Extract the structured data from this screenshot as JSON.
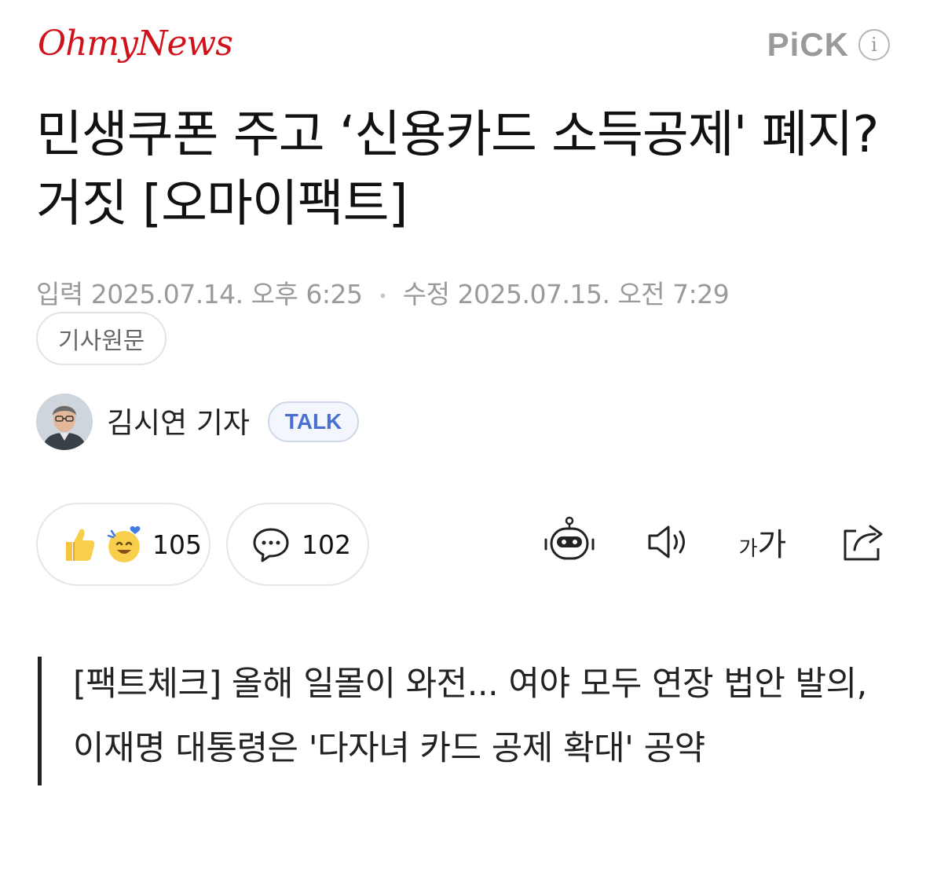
{
  "header": {
    "logo": "OhmyNews",
    "pick_label": "PiCK",
    "info_icon": "info-icon",
    "info_glyph": "i"
  },
  "article": {
    "headline": "민생쿠폰 주고 ‘신용카드 소득공제' 폐지? 거짓 [오마이팩트]",
    "input_label": "입력",
    "input_datetime": "2025.07.14. 오후 6:25",
    "modified_label": "수정",
    "modified_datetime": "2025.07.15. 오전 7:29",
    "separator": "•",
    "source_button": "기사원문",
    "reporter_name": "김시연 기자",
    "talk_label": "TALK",
    "reaction_count": "105",
    "comment_count": "102",
    "font_small": "가",
    "font_big": "가",
    "summary": "[팩트체크] 올해 일몰이 와전... 여야 모두 연장 법안 발의, 이재명 대통령은 '다자녀 카드 공제 확대' 공약"
  },
  "colors": {
    "brand_red": "#d0121a",
    "talk_blue": "#4a6fd3",
    "meta_gray": "#9a9a9a"
  },
  "icons": [
    "thumbs-up-icon",
    "smile-heart-icon",
    "comment-icon",
    "robot-icon",
    "speaker-icon",
    "font-size-icon",
    "share-icon"
  ]
}
